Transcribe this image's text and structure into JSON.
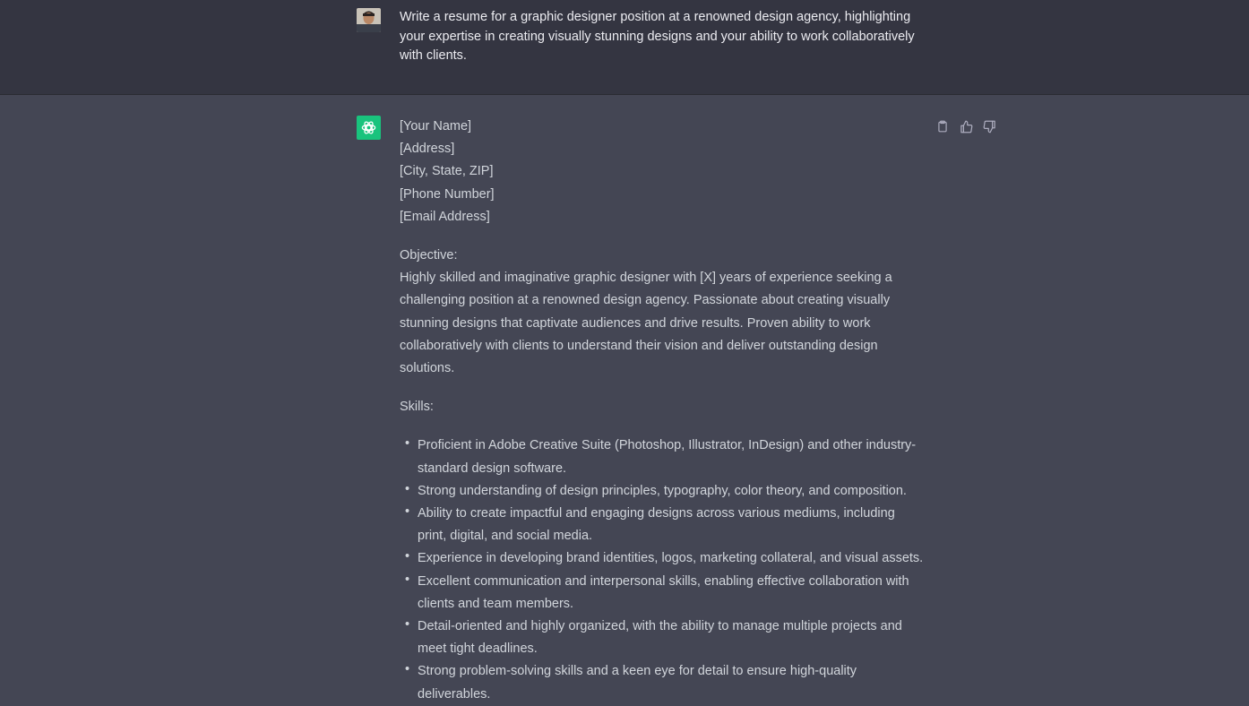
{
  "user_message": {
    "text": "Write a resume for a graphic designer position at a renowned design agency, highlighting your expertise in creating visually stunning designs and your ability to work collaboratively with clients."
  },
  "assistant_message": {
    "contact": [
      "[Your Name]",
      "[Address]",
      "[City, State, ZIP]",
      "[Phone Number]",
      "[Email Address]"
    ],
    "objective_heading": "Objective:",
    "objective_text": "Highly skilled and imaginative graphic designer with [X] years of experience seeking a challenging position at a renowned design agency. Passionate about creating visually stunning designs that captivate audiences and drive results. Proven ability to work collaboratively with clients to understand their vision and deliver outstanding design solutions.",
    "skills_heading": "Skills:",
    "skills": [
      "Proficient in Adobe Creative Suite (Photoshop, Illustrator, InDesign) and other industry-standard design software.",
      "Strong understanding of design principles, typography, color theory, and composition.",
      "Ability to create impactful and engaging designs across various mediums, including print, digital, and social media.",
      "Experience in developing brand identities, logos, marketing collateral, and visual assets.",
      "Excellent communication and interpersonal skills, enabling effective collaboration with clients and team members.",
      "Detail-oriented and highly organized, with the ability to manage multiple projects and meet tight deadlines.",
      "Strong problem-solving skills and a keen eye for detail to ensure high-quality deliverables."
    ]
  },
  "icons": {
    "copy": "clipboard-icon",
    "like": "thumbs-up-icon",
    "dislike": "thumbs-down-icon",
    "assistant": "openai-logo-icon"
  },
  "colors": {
    "user_bg": "#343541",
    "assistant_bg": "#444654",
    "assistant_avatar": "#19c37d"
  }
}
